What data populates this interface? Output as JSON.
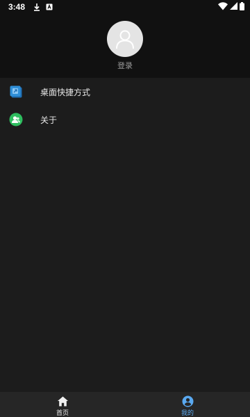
{
  "status_bar": {
    "time": "3:48",
    "icons": [
      "download-icon",
      "app-notification-icon",
      "wifi-icon",
      "signal-icon",
      "battery-icon"
    ]
  },
  "profile": {
    "login_label": "登录",
    "avatar_icon": "person-icon"
  },
  "menu": {
    "items": [
      {
        "label": "桌面快捷方式",
        "icon": "shortcut-icon",
        "color": "#2f8fd8"
      },
      {
        "label": "关于",
        "icon": "about-icon",
        "color": "#2ebd5f"
      }
    ]
  },
  "bottom_nav": {
    "tabs": [
      {
        "label": "首页",
        "icon": "home-icon",
        "active": false
      },
      {
        "label": "我的",
        "icon": "profile-icon",
        "active": true
      }
    ],
    "active_color": "#5aa9f0"
  }
}
